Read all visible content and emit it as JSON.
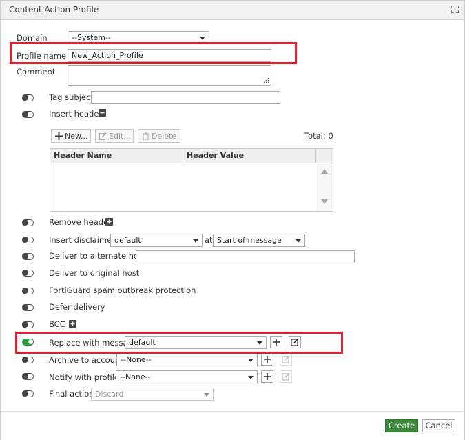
{
  "dialog": {
    "title": "Content Action Profile"
  },
  "form": {
    "domain": {
      "label": "Domain",
      "value": "--System--"
    },
    "profile_name": {
      "label": "Profile name",
      "value": "New_Action_Profile"
    },
    "comment": {
      "label": "Comment",
      "value": ""
    },
    "tag_subject": {
      "label": "Tag subject",
      "value": ""
    },
    "insert_header": {
      "label": "Insert header"
    },
    "header_table": {
      "new_label": "New...",
      "edit_label": "Edit...",
      "delete_label": "Delete",
      "total_label": "Total: 0",
      "columns": [
        "Header Name",
        "Header Value"
      ]
    },
    "remove_header": {
      "label": "Remove header"
    },
    "insert_disclaimer": {
      "label": "Insert disclaimer",
      "value": "default",
      "at_label": "at",
      "position_value": "Start of message"
    },
    "deliver_alternate": {
      "label": "Deliver to alternate host",
      "value": ""
    },
    "deliver_original": {
      "label": "Deliver to original host"
    },
    "fortiguard": {
      "label": "FortiGuard spam outbreak protection"
    },
    "defer_delivery": {
      "label": "Defer delivery"
    },
    "bcc": {
      "label": "BCC"
    },
    "replace_message": {
      "label": "Replace with message",
      "value": "default",
      "enabled": true
    },
    "archive_account": {
      "label": "Archive to account",
      "value": "--None--"
    },
    "notify_profile": {
      "label": "Notify with profile",
      "value": "--None--"
    },
    "final_action": {
      "label": "Final action",
      "value": "Discard"
    }
  },
  "footer": {
    "create_label": "Create",
    "cancel_label": "Cancel"
  },
  "colors": {
    "accent_green": "#3a8a3a",
    "highlight_red": "#e02030",
    "toggle_on": "#2a9d3e"
  }
}
